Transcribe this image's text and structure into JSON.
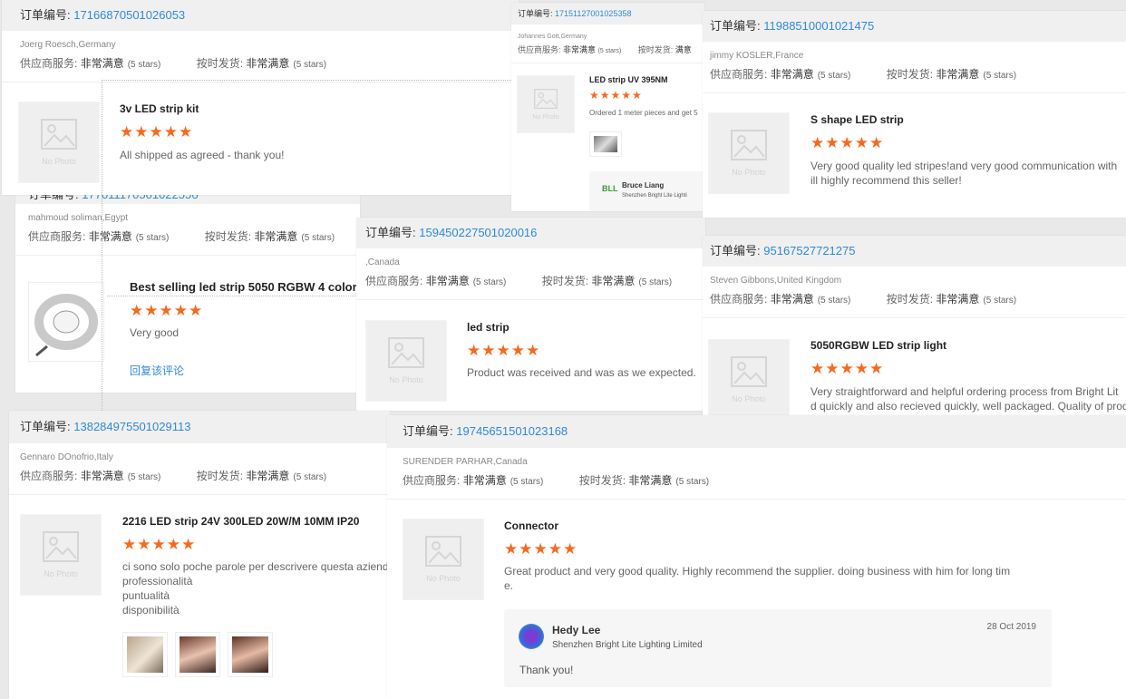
{
  "common": {
    "order_prefix": "订单编号:",
    "service_label": "供应商服务:",
    "shipping_label": "按时发货:",
    "rating_value": "非常满意",
    "rating_stars": "(5 stars)",
    "stars": "★★★★★",
    "no_photo": "No Photo"
  },
  "card1": {
    "order_number": "17166870501026053",
    "buyer": "Joerg Roesch,Germany",
    "product": "3v LED strip kit",
    "review": "All shipped as agreed - thank you!"
  },
  "card2": {
    "order_number": "17151127001025358",
    "buyer": "Johannes Gott,Germany",
    "shipping_rating": "满意",
    "product": "LED strip UV 395NM",
    "review": "Ordered 1 meter pieces and get 5",
    "reply_name": "Bruce Liang",
    "reply_company": "Shenzhen Bright Lite Lighti"
  },
  "card3": {
    "order_number": "119885100010214​75",
    "buyer": "jimmy KOSLER,France",
    "product": "S shape LED strip",
    "review_line1": "Very good quality led stripes!and very good communication with",
    "review_line2": "ill highly recommend this seller!"
  },
  "card4": {
    "order_number_partial": "17701117050102255б",
    "buyer": "mahmoud soliman,Egypt",
    "product": "Best selling led strip 5050 RGBW 4 color",
    "review": "Very good",
    "reply_link": "回复该评论"
  },
  "card5": {
    "order_number": "159450227501020016",
    "buyer": ",Canada",
    "product": "led strip",
    "review": "Product was received and was as we expected."
  },
  "card6": {
    "order_number": "95167527721275",
    "buyer": "Steven Gibbons,United Kingdom",
    "product": "5050RGBW LED strip light",
    "review_line1": "Very straightforward and helpful ordering process from Bright Lit",
    "review_line2": "d quickly and also recieved quickly, well packaged. Quality of prod"
  },
  "card7": {
    "order_number": "138284975501029113",
    "buyer": "Gennaro DOnofrio,Italy",
    "product": "2216 LED strip 24V 300LED 20W/M 10MM IP20",
    "review_lines": [
      "ci sono solo poche parole per descrivere questa aziend",
      "professionalità",
      "puntualità",
      "disponibilità"
    ]
  },
  "card8": {
    "order_number": "19745651501023168",
    "buyer": "SURENDER PARHAR,Canada",
    "product": "Connector",
    "review_line1": "Great product and very good quality. Highly recommend the supplier. doing business with him for long tim",
    "review_line2": "e.",
    "reply_name": "Hedy Lee",
    "reply_company": "Shenzhen Bright Lite Lighting Limited",
    "reply_date": "28 Oct 2019",
    "reply_text": "Thank you!"
  },
  "colors": {
    "accent": "#2e8ad8",
    "star": "#f46a1f",
    "header_bg": "#f0f0f0"
  }
}
